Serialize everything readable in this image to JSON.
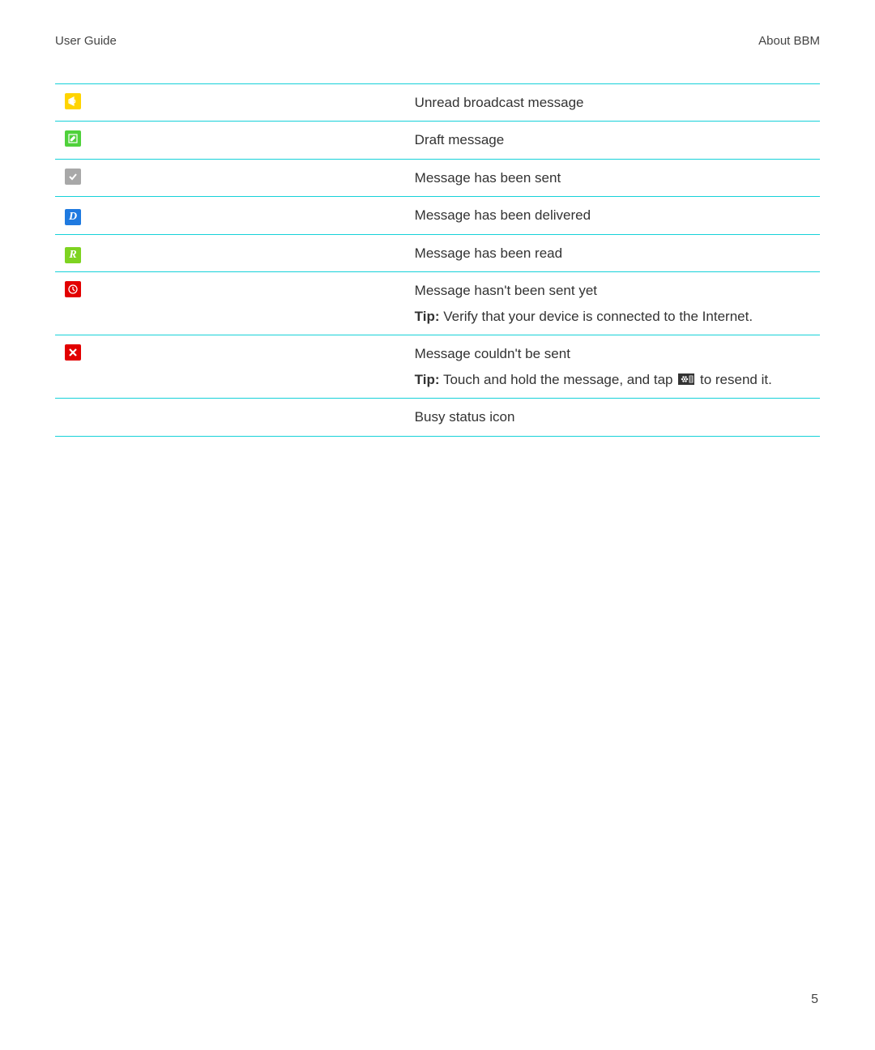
{
  "header": {
    "left": "User Guide",
    "right": "About BBM"
  },
  "rows": [
    {
      "icon": "broadcast-icon",
      "label": "Unread broadcast message"
    },
    {
      "icon": "draft-icon",
      "label": "Draft message"
    },
    {
      "icon": "sent-icon",
      "label": "Message has been sent"
    },
    {
      "icon": "delivered-icon",
      "label": "Message has been delivered"
    },
    {
      "icon": "read-icon",
      "label": "Message has been read"
    },
    {
      "icon": "pending-icon",
      "label": "Message hasn't been sent yet",
      "tip": "Verify that your device is connected to the Internet."
    },
    {
      "icon": "failed-icon",
      "label": "Message couldn't be sent",
      "tip_pre": "Touch and hold the message, and tap",
      "tip_post": "to resend it.",
      "tip_inline_icon": "bb-menu-icon"
    },
    {
      "icon": "busy-icon",
      "label": "Busy status icon"
    }
  ],
  "tip_label": "Tip:",
  "page_number": "5"
}
